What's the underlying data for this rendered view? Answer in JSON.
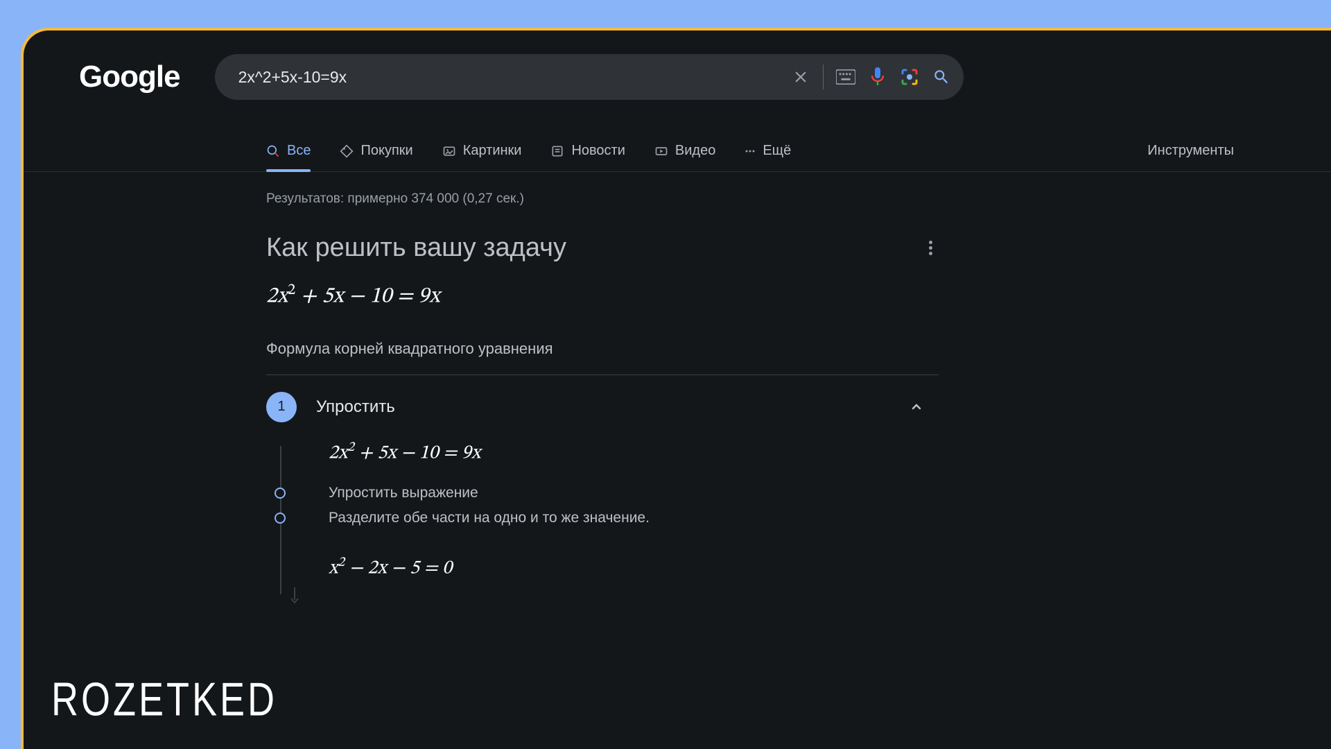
{
  "logo": "Google",
  "search": {
    "query": "2x^2+5x-10=9x"
  },
  "tabs": {
    "all": "Все",
    "shopping": "Покупки",
    "images": "Картинки",
    "news": "Новости",
    "video": "Видео",
    "more": "Ещё",
    "tools": "Инструменты"
  },
  "results_stats": "Результатов: примерно 374 000 (0,27 сек.)",
  "solver": {
    "title": "Как решить вашу задачу",
    "equation_html": "2x² + 5x − 10 = 9x",
    "method": "Формула корней квадратного уравнения",
    "step1": {
      "num": "1",
      "title": "Упростить",
      "eq_start": "2x² + 5x − 10 = 9x",
      "sub1": "Упростить выражение",
      "sub2": "Разделите обе части на одно и то же значение.",
      "eq_result": "x² − 2x − 5 = 0"
    }
  },
  "watermark": "ROZETKED"
}
